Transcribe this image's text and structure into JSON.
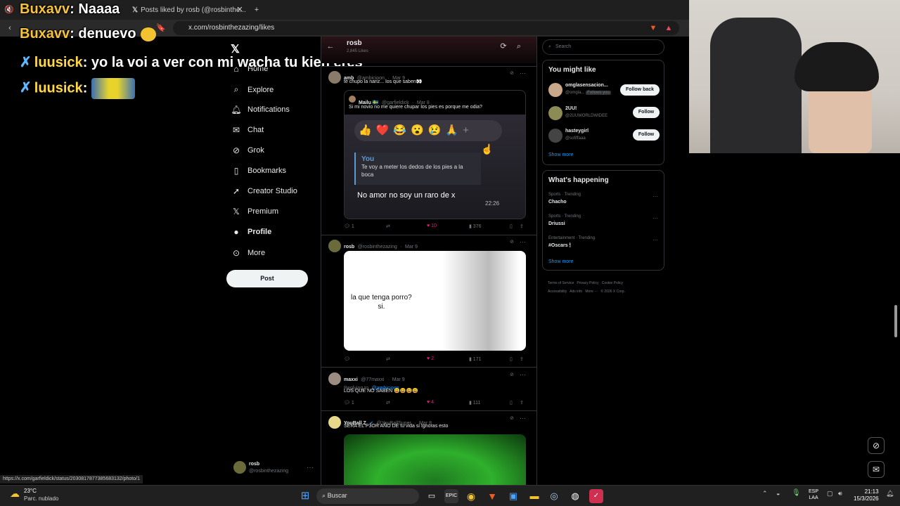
{
  "browser": {
    "tabs": [
      "Posts liked by rosb (@rosbinthe..."
    ],
    "url": "x.com/rosbinthezazing/likes",
    "status_url": "https://x.com/garfieldick/status/2030817877385683132/photo/1"
  },
  "chat": [
    {
      "user": "Buxavv",
      "text": ": Naaaa"
    },
    {
      "user": "Buxavv",
      "text": ": denuevo"
    },
    {
      "user": "luusick",
      "text": ": yo la voi a ver con mi wacha tu kien eres"
    },
    {
      "user": "luusick",
      "text": ":"
    }
  ],
  "nav": {
    "items": [
      "Home",
      "Explore",
      "Notifications",
      "Chat",
      "Grok",
      "Bookmarks",
      "Creator Studio",
      "Premium",
      "Profile",
      "More"
    ],
    "post_label": "Post",
    "account_name": "rosb",
    "account_handle": "@rosbinthezazing"
  },
  "header": {
    "title": "rosb",
    "subtitle": "2,845 Likes"
  },
  "posts": [
    {
      "name": "amb",
      "handle": "@ambicioon",
      "date": "Mar 9",
      "text": "te chupo la nariz... los que saben👀",
      "quote": {
        "name": "Mailu 🇸🇪",
        "handle": "@garfieldick",
        "date": "Mar 8",
        "text": "Si mi novio no me quiere chupar los pies es porque me odia?",
        "reply_author": "You",
        "reply_text": "Te voy a meter los dedos de los pies a la boca",
        "message": "No amor no soy un raro de x",
        "time": "22:26"
      },
      "replies": "1",
      "likes": "10",
      "views": "376"
    },
    {
      "name": "rosb",
      "handle": "@rosbinthezazing",
      "date": "Mar 9",
      "image_text": "la que tenga porro?\nsi.",
      "likes": "2",
      "views": "171"
    },
    {
      "name": "maxxi",
      "handle": "@77maxxi",
      "date": "Mar 9",
      "replying": "Replying to",
      "replying_to": "@ambicioon",
      "text": "LOS QUE NO SABEN 😃😃😃😃",
      "replies": "1",
      "likes": "4",
      "views": "111"
    },
    {
      "name": "YouBall Z",
      "handle": "@YouBallSuper",
      "date": "Mar 8",
      "text": "SERA EL P3OR AÑO DE tu vida si Ignoras esto"
    }
  ],
  "search": {
    "placeholder": "Search"
  },
  "who_to_follow": {
    "title": "You might like",
    "users": [
      {
        "name": "omglasensacion...",
        "handle": "@omgla...",
        "badge": "Follows you",
        "button": "Follow back"
      },
      {
        "name": "2UU!",
        "handle": "@2UUWORLDWIDEE",
        "button": "Follow"
      },
      {
        "name": "hasteygirl",
        "handle": "@sofiffaaa",
        "button": "Follow"
      }
    ],
    "show_more": "Show more"
  },
  "trending": {
    "title": "What's happening",
    "items": [
      {
        "context": "Sports · Trending",
        "name": "Chacho"
      },
      {
        "context": "Sports · Trending",
        "name": "Driussi"
      },
      {
        "context": "Entertainment · Trending",
        "name": "#Oscars 🕯"
      }
    ],
    "show_more": "Show more"
  },
  "footer": [
    "Terms of Service",
    "Privacy Policy",
    "Cookie Policy",
    "Accessibility",
    "Ads info",
    "More ···",
    "© 2026 X Corp."
  ],
  "taskbar": {
    "weather_temp": "23°C",
    "weather_desc": "Parc. nublado",
    "search": "Buscar",
    "lang_top": "ESP",
    "lang_bottom": "LAA",
    "time": "21:13",
    "date": "15/3/2026"
  },
  "colors": {
    "accent": "#1d9bf0",
    "like": "#f91880",
    "background": "#000000",
    "border": "#2f3336"
  }
}
